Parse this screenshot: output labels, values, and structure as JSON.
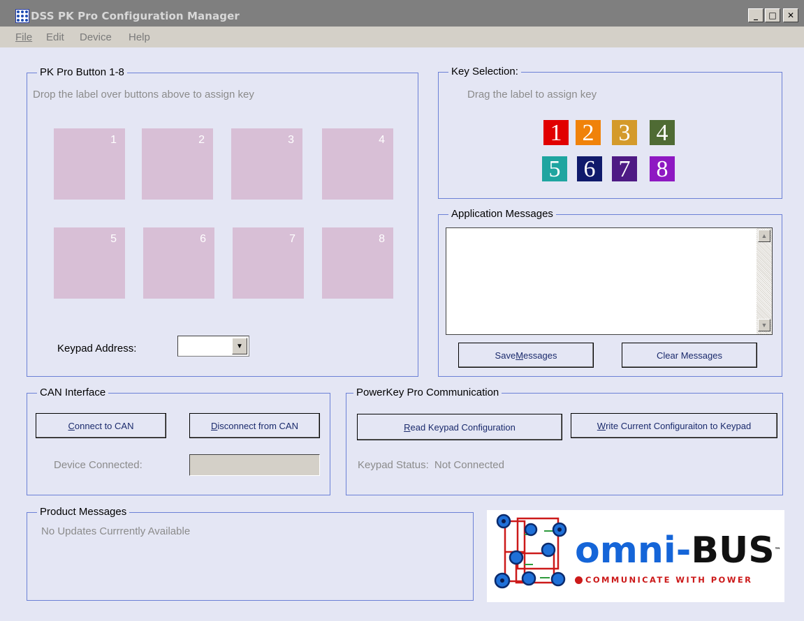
{
  "window": {
    "title": "DSS PK Pro Configuration Manager",
    "controls": {
      "minimize": "_",
      "maximize": "□",
      "close": "✕"
    }
  },
  "menu": {
    "items": [
      "File",
      "Edit",
      "Device",
      "Help"
    ]
  },
  "pk_buttons": {
    "title": "PK Pro Button 1-8",
    "hint": "Drop the label over buttons above to assign key",
    "slots": [
      "1",
      "2",
      "3",
      "4",
      "5",
      "6",
      "7",
      "8"
    ],
    "address_label": "Keypad Address:",
    "address_value": ""
  },
  "key_selection": {
    "title": "Key Selection:",
    "hint": "Drag the label to assign key",
    "keys": [
      {
        "label": "1",
        "color": "#e10000"
      },
      {
        "label": "2",
        "color": "#f0820a"
      },
      {
        "label": "3",
        "color": "#d49a2b"
      },
      {
        "label": "4",
        "color": "#4f6b34"
      },
      {
        "label": "5",
        "color": "#1fa5a0"
      },
      {
        "label": "6",
        "color": "#101a6b"
      },
      {
        "label": "7",
        "color": "#4e1a84"
      },
      {
        "label": "8",
        "color": "#8e18c2"
      }
    ]
  },
  "app_messages": {
    "title": "Application Messages",
    "content": "",
    "save_prefix": "Save ",
    "save_underlined": "M",
    "save_suffix": "essages",
    "clear_label": "Clear Messages"
  },
  "can_interface": {
    "title": "CAN Interface",
    "connect_underlined": "C",
    "connect_rest": "onnect to CAN",
    "disconnect_underlined": "D",
    "disconnect_rest": "isconnect from CAN",
    "device_label": "Device Connected:",
    "device_value": ""
  },
  "powerkey": {
    "title": "PowerKey Pro Communication",
    "read_underlined": "R",
    "read_rest": "ead Keypad Configuration",
    "write_underlined": "W",
    "write_rest": "rite Current Configuraiton to Keypad",
    "status_label": "Keypad Status:",
    "status_value": "Not Connected"
  },
  "product_messages": {
    "title": "Product Messages",
    "text": "No Updates Currrently Available"
  },
  "logo": {
    "brand_omni": "omni-",
    "brand_bus": "BUS",
    "tm": "™",
    "tagline": "COMMUNICATE WITH POWER",
    "colors": {
      "blue": "#1565d8",
      "black": "#111111",
      "red": "#cc1a1a",
      "green": "#2e9a3c"
    }
  }
}
